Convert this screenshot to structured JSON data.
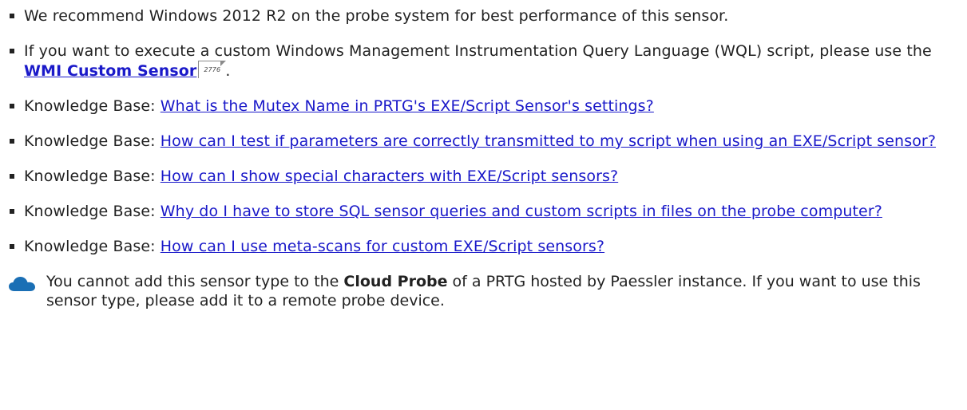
{
  "items": [
    {
      "text": "We recommend Windows 2012 R2 on the probe system for best performance of this sensor."
    },
    {
      "prefix": "If you want to execute a custom Windows Management Instrumentation Query Language (WQL) script, please use the ",
      "link": "WMI Custom Sensor",
      "page_ref": "2776",
      "suffix": "."
    },
    {
      "prefix": "Knowledge Base: ",
      "link": "What is the Mutex Name in PRTG's EXE/Script Sensor's settings?"
    },
    {
      "prefix": "Knowledge Base: ",
      "link": "How can I test if parameters are correctly transmitted to my script when using an EXE/Script sensor?"
    },
    {
      "prefix": "Knowledge Base: ",
      "link": "How can I show special characters with EXE/Script sensors?"
    },
    {
      "prefix": "Knowledge Base: ",
      "link": "Why do I have to store SQL sensor queries and custom scripts in files on the probe computer?"
    },
    {
      "prefix": "Knowledge Base: ",
      "link": "How can I use meta-scans for custom EXE/Script sensors?"
    }
  ],
  "notice": {
    "icon": "cloud-icon",
    "text_before": "You cannot add this sensor type to the ",
    "bold": "Cloud Probe",
    "text_after": " of a PRTG hosted by Paessler instance. If you want to use this sensor type, please add it to a remote probe device."
  },
  "colors": {
    "link": "#1a19c9",
    "text": "#222222",
    "icon": "#1a6fb5"
  }
}
